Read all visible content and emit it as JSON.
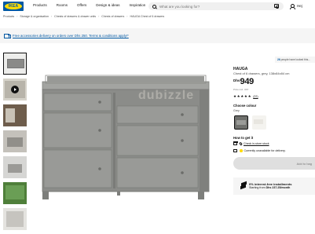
{
  "header": {
    "logo_text": "IKEA",
    "nav": [
      "Products",
      "Rooms",
      "Offers",
      "Design & ideas",
      "Inspiration"
    ],
    "search_placeholder": "What are you looking for?",
    "greeting": "Hej"
  },
  "breadcrumb": [
    "Products",
    "Storage & organisation",
    "Chests of drawers & drawer units",
    "Chests of drawers",
    "HAUGA Chest of 6 drawers"
  ],
  "banner": {
    "text": "Free accessories delivery on orders over Dhs 250. Terms & conditions apply!*"
  },
  "product": {
    "social_count": "26",
    "social_text": "people have looked this...",
    "name": "HAUGA",
    "description": "Chest of 6 drawers, grey, 138x84x84 cm",
    "currency": "Dhs",
    "price": "949",
    "price_note": "Price incl. VAT",
    "rating": 4.5,
    "review_count": "(22)",
    "choose_colour_label": "Choose colour",
    "colour_name": "Grey",
    "colours": [
      {
        "name": "grey",
        "hex": "#6f706d"
      },
      {
        "name": "white",
        "hex": "#f4f3ef"
      }
    ],
    "how_to_get": "How to get it",
    "store_label": "Check in-store stock",
    "delivery_label": "Currently unavailable for delivery.",
    "add_button": "Add to bag",
    "installments_title": "0% interest-free installments",
    "installments_prefix": "Starting from",
    "installments_amount": "Dhs 237.25/month"
  },
  "watermark": "dubizzle",
  "colors": {
    "brand_blue": "#0058a3",
    "brand_yellow": "#ffdb00",
    "dresser": "#8e8f8c"
  }
}
